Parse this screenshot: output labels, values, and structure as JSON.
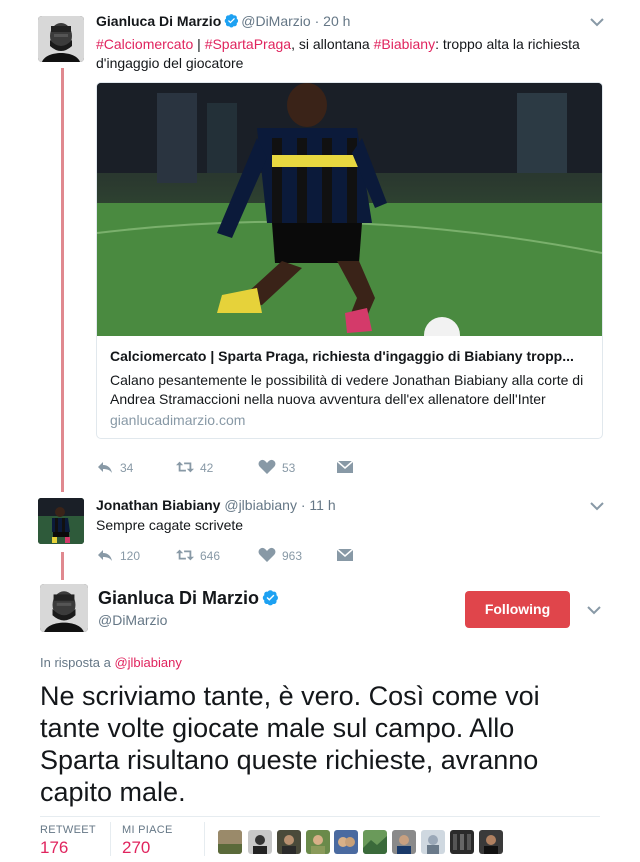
{
  "tweet1": {
    "name": "Gianluca Di Marzio",
    "handle": "@DiMarzio",
    "dot": "·",
    "time": "20 h",
    "text_hashtag1": "#Calciomercato",
    "text_sep1": " | ",
    "text_hashtag2": "#SpartaPraga",
    "text_mid": ", si allontana ",
    "text_hashtag3": "#Biabiany",
    "text_end": ": troppo alta la richiesta d'ingaggio del giocatore",
    "card": {
      "title": "Calciomercato | Sparta Praga, richiesta d'ingaggio di Biabiany tropp...",
      "description": "Calano pesantemente le possibilità di vedere Jonathan Biabiany alla corte di Andrea Stramaccioni nella nuova avventura dell'ex allenatore dell'Inter",
      "domain": "gianlucadimarzio.com"
    },
    "actions": {
      "replies": "34",
      "retweets": "42",
      "likes": "53"
    }
  },
  "tweet2": {
    "name": "Jonathan Biabiany",
    "handle": "@jlbiabiany",
    "dot": "·",
    "time": "11 h",
    "text": "Sempre cagate scrivete",
    "actions": {
      "replies": "120",
      "retweets": "646",
      "likes": "963"
    }
  },
  "main": {
    "name": "Gianluca Di Marzio",
    "handle": "@DiMarzio",
    "follow_label": "Following",
    "reply_prefix": "In risposta a ",
    "reply_mention": "@jlbiabiany",
    "text": "Ne scriviamo tante, è vero. Così come voi tante volte giocate male sul campo. Allo Sparta risultano queste richieste, avranno capito male.",
    "stats": {
      "retweet_label": "RETWEET",
      "retweet_value": "176",
      "like_label": "MI PIACE",
      "like_value": "270"
    }
  },
  "colors": {
    "accent": "#e0245e",
    "follow_button": "#e0454b",
    "thread_line": "#e0898f",
    "verified": "#1da1f2",
    "muted": "#8899a6"
  },
  "icons": [
    "verified-badge-icon",
    "chevron-down-icon",
    "reply-icon",
    "retweet-icon",
    "like-icon",
    "direct-message-icon"
  ]
}
